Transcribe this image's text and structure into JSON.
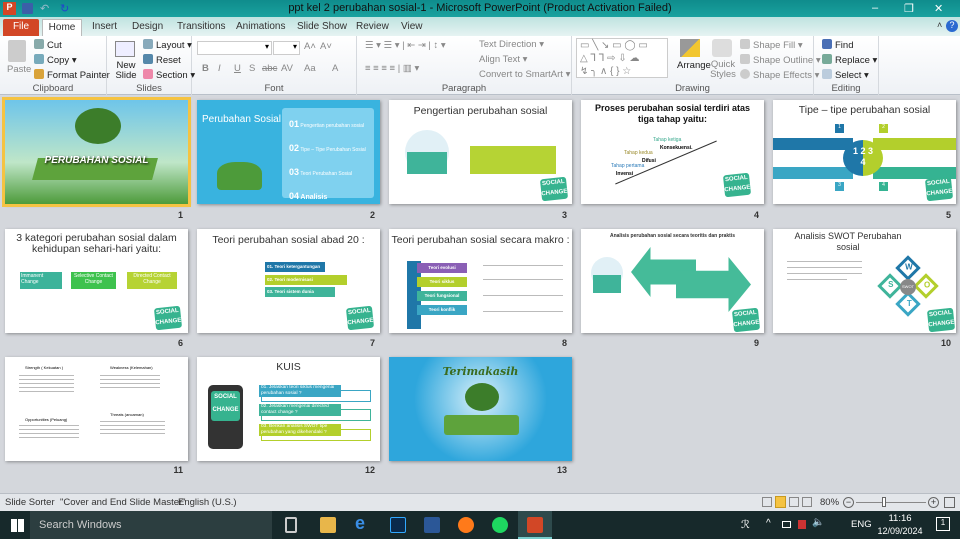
{
  "window": {
    "title": "ppt kel 2 perubahan sosial-1  -  Microsoft PowerPoint (Product Activation Failed)",
    "minimize": "–",
    "restore": "❐",
    "close": "✕",
    "help": "?"
  },
  "tabs": [
    "File",
    "Home",
    "Insert",
    "Design",
    "Transitions",
    "Animations",
    "Slide Show",
    "Review",
    "View"
  ],
  "ribbon": {
    "clipboard": {
      "label": "Clipboard",
      "paste": "Paste",
      "cut": "Cut",
      "copy": "Copy",
      "format_painter": "Format Painter"
    },
    "slides": {
      "label": "Slides",
      "new_slide": "New Slide",
      "layout": "Layout",
      "reset": "Reset",
      "section": "Section"
    },
    "font": {
      "label": "Font",
      "bold": "B",
      "italic": "I",
      "underline": "U",
      "shadow": "S",
      "strike": "abc",
      "spacing": "AV",
      "case": "Aa",
      "color": "A",
      "grow": "A˄",
      "shrink": "A˅"
    },
    "paragraph": {
      "label": "Paragraph",
      "text_direction": "Text Direction",
      "align_text": "Align Text",
      "smartart": "Convert to SmartArt"
    },
    "drawing": {
      "label": "Drawing",
      "arrange": "Arrange",
      "quick_styles": "Quick Styles",
      "shape_fill": "Shape Fill",
      "shape_outline": "Shape Outline",
      "shape_effects": "Shape Effects"
    },
    "editing": {
      "label": "Editing",
      "find": "Find",
      "replace": "Replace",
      "select": "Select"
    }
  },
  "slides": [
    {
      "n": "1",
      "title": "PERUBAHAN SOSIAL"
    },
    {
      "n": "2",
      "title": "Perubahan Sosial",
      "items": [
        {
          "num": "01",
          "text": "Pengertian perubahan sosial"
        },
        {
          "num": "02",
          "text": "Tipe – Tipe Perubahan Sosial"
        },
        {
          "num": "03",
          "text": "Teori Perubahan Sosial"
        },
        {
          "num": "04",
          "text": "Analisis"
        }
      ]
    },
    {
      "n": "3",
      "title": "Pengertian perubahan sosial"
    },
    {
      "n": "4",
      "title": "Proses perubahan sosial terdiri atas tiga tahap yaitu:",
      "steps": [
        {
          "label": "Tahap pertama",
          "value": "Invensi"
        },
        {
          "label": "Tahap kedua",
          "value": "Difusi"
        },
        {
          "label": "Tahap ketiga",
          "value": "Konsekuensi."
        }
      ]
    },
    {
      "n": "5",
      "title": "Tipe – tipe perubahan sosial",
      "center": "1 2 3 4",
      "badges": [
        "1",
        "2",
        "3",
        "4"
      ]
    },
    {
      "n": "6",
      "title": "3 kategori perubahan sosial dalam kehidupan sehari-hari yaitu:",
      "boxes": [
        "Immanent Change",
        "Selective Contact Change",
        "Directed Contact Change"
      ]
    },
    {
      "n": "7",
      "title": "Teori perubahan sosial abad 20 :",
      "arrows": [
        "01. Teori ketergantungan",
        "02. Teori modernisasi",
        "03. Teori sistem dunia"
      ]
    },
    {
      "n": "8",
      "title": "Teori perubahan sosial secara makro :",
      "levels": [
        "Teori evolusi",
        "Teori siklus",
        "Teori fungsional",
        "Teori konflik"
      ]
    },
    {
      "n": "9",
      "title": "Analisis perubahan sosial secara teoritis dan praktis"
    },
    {
      "n": "10",
      "title": "Analisis SWOT Perubahan sosial",
      "swot": [
        "W",
        "S",
        "O",
        "T"
      ],
      "center": "SWOT"
    },
    {
      "n": "11",
      "headings": [
        "Strength ( Kekuatan )",
        "Weakness (Kelemahan)",
        "Opportunities (Peluang)",
        "Threats (ancaman)"
      ]
    },
    {
      "n": "12",
      "title": "KUIS",
      "questions": [
        "01. Jelaskan teori siklus mengenai perubahan sosial ?",
        "02. Jelaskan mengenai directed contact change ?",
        "03. Berikan analisis SWOT tipe perubahan yang dikehendaki ?"
      ]
    },
    {
      "n": "13",
      "title": "Terimakasih"
    }
  ],
  "logo_text": "SOCIAL CHANGE",
  "status": {
    "view": "Slide Sorter",
    "theme": "\"Cover and End Slide Master\"",
    "language": "English (U.S.)",
    "zoom": "80%"
  },
  "taskbar": {
    "search": "Search Windows",
    "time": "11:16",
    "date": "12/09/2024",
    "lang": "ENG",
    "notif": "1"
  }
}
